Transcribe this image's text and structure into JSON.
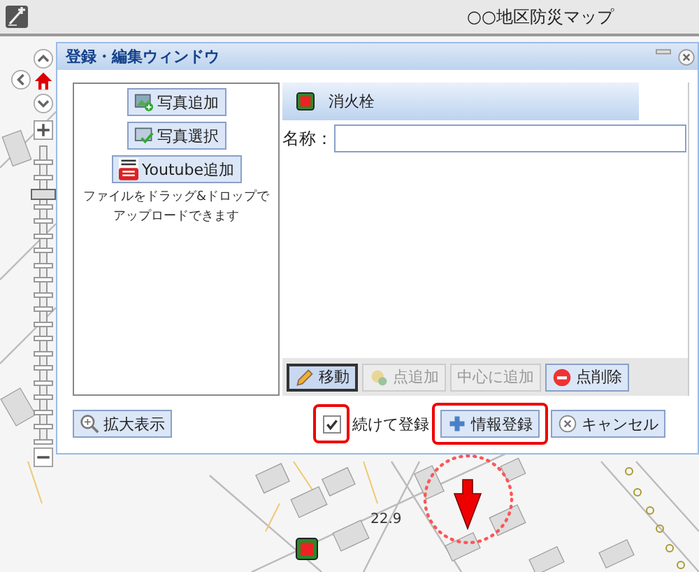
{
  "app_bar": {
    "title": "○○地区防災マップ"
  },
  "dialog": {
    "title": "登録・編集ウィンドウ",
    "media_buttons": [
      {
        "kind": "photo-add",
        "label": "写真追加"
      },
      {
        "kind": "photo-select",
        "label": "写真選択"
      },
      {
        "kind": "youtube",
        "label": "Youtube追加"
      }
    ],
    "drop_hint": [
      "ファイルをドラッグ&ドロップで",
      "アップロードできます"
    ],
    "category": {
      "label": "消火栓"
    },
    "name_field": {
      "label": "名称："
    },
    "tools": [
      {
        "kind": "move",
        "label": "移動",
        "selected": true,
        "disabled": false
      },
      {
        "kind": "add-point",
        "label": "点追加",
        "selected": false,
        "disabled": true
      },
      {
        "kind": "add-center",
        "label": "中心に追加",
        "selected": false,
        "disabled": true
      },
      {
        "kind": "delete-point",
        "label": "点削除",
        "selected": false,
        "disabled": false
      }
    ],
    "zoom_button": {
      "label": "拡大表示"
    },
    "continue_checkbox": {
      "label": "続けて登録",
      "checked": true,
      "highlighted": true
    },
    "register_button": {
      "label": "情報登録",
      "highlighted": true
    },
    "cancel_button": {
      "label": "キャンセル"
    }
  },
  "map": {
    "elevation_label": "22.9",
    "zoom_slider": {
      "level": 0.85
    }
  }
}
